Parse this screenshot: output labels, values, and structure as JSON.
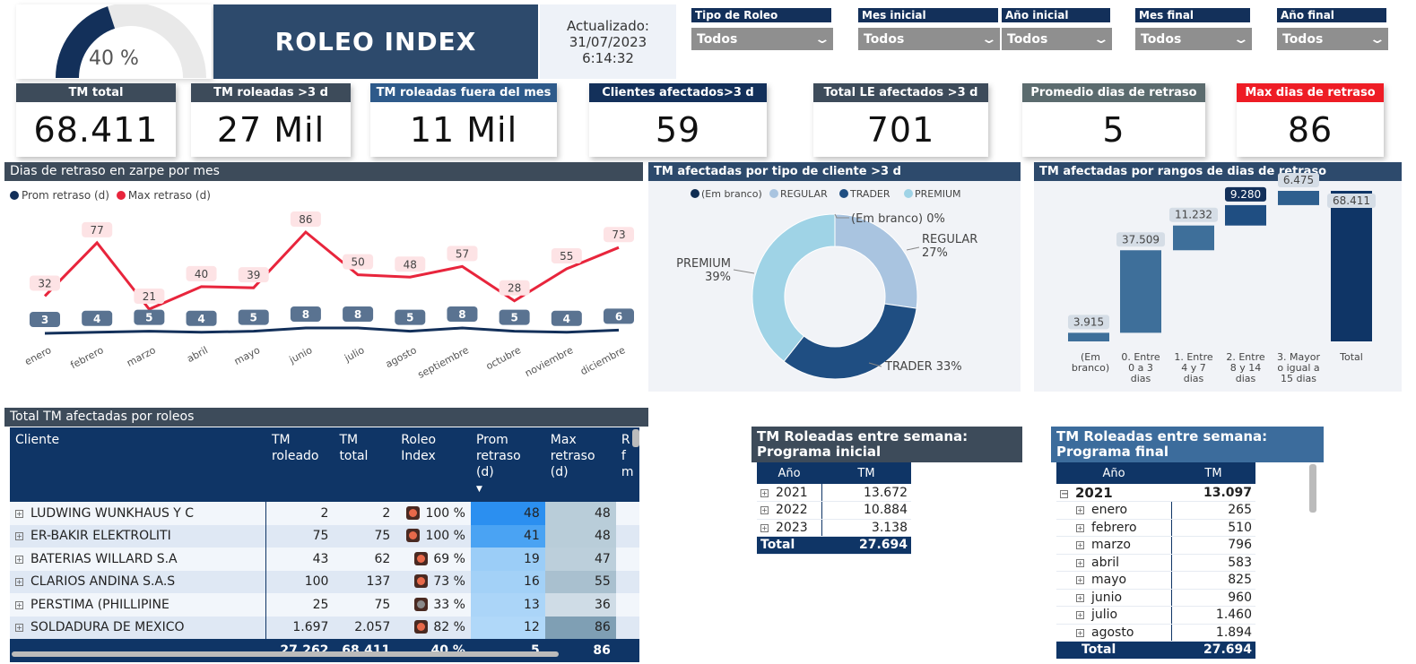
{
  "gauge": {
    "value_percent": 40,
    "label": "40 %",
    "fill_color": "#13305a",
    "track_color": "#e9e9e9"
  },
  "header": {
    "title": "ROLEO INDEX",
    "updated_label": "Actualizado:",
    "updated_date": "31/07/2023",
    "updated_time": "6:14:32"
  },
  "filters": [
    {
      "label": "Tipo de Roleo",
      "value": "Todos"
    },
    {
      "label": "Mes inicial",
      "value": "Todos"
    },
    {
      "label": "Año inicial",
      "value": "Todos"
    },
    {
      "label": "Mes final",
      "value": "Todos"
    },
    {
      "label": "Año final",
      "value": "Todos"
    }
  ],
  "kpis": [
    {
      "label": "TM total",
      "value": "68.411",
      "color": "#3d4b5a"
    },
    {
      "label": "TM roleadas >3 d",
      "value": "27 Mil",
      "color": "#3d4b5a"
    },
    {
      "label": "TM roleadas fuera del mes",
      "value": "11 Mil",
      "color": "#2e5a8a"
    },
    {
      "label": "Clientes afectados>3 d",
      "value": "59",
      "color": "#13305a"
    },
    {
      "label": "Total LE afectados >3 d",
      "value": "701",
      "color": "#3d4b5a"
    },
    {
      "label": "Promedio dias de retraso",
      "value": "5",
      "color": "#5b6b6e"
    },
    {
      "label": "Max dias de retraso",
      "value": "86",
      "color": "#ee1c25"
    }
  ],
  "line_section": {
    "title": "Dias de retraso en zarpe por mes",
    "legend": [
      {
        "name": "Prom retraso (d)",
        "color": "#13305a"
      },
      {
        "name": "Max retraso (d)",
        "color": "#e8253c"
      }
    ]
  },
  "donut_section": {
    "title": "TM afectadas por tipo de cliente >3 d",
    "legend": [
      {
        "name": "(Em branco)",
        "color": "#0f2d52"
      },
      {
        "name": "REGULAR",
        "color": "#a9c4e0"
      },
      {
        "name": "TRADER",
        "color": "#1f4e82"
      },
      {
        "name": "PREMIUM",
        "color": "#9fd3e6"
      }
    ]
  },
  "water_section": {
    "title": "TM afectadas por rangos de dias de retraso"
  },
  "chart_data": [
    {
      "type": "line",
      "x": [
        "enero",
        "febrero",
        "marzo",
        "abril",
        "mayo",
        "junio",
        "julio",
        "agosto",
        "septiembre",
        "octubre",
        "noviembre",
        "diciembre"
      ],
      "series": [
        {
          "name": "Prom retraso (d)",
          "values": [
            3,
            4,
            5,
            4,
            5,
            8,
            8,
            5,
            8,
            5,
            4,
            6
          ]
        },
        {
          "name": "Max retraso (d)",
          "values": [
            32,
            77,
            21,
            40,
            39,
            86,
            50,
            48,
            57,
            28,
            55,
            73
          ]
        }
      ],
      "title": "Dias de retraso en zarpe por mes"
    },
    {
      "type": "pie",
      "categories": [
        "(Em branco)",
        "REGULAR",
        "TRADER",
        "PREMIUM"
      ],
      "values": [
        0,
        27,
        33,
        39
      ],
      "slice_labels": [
        "(Em branco) 0%",
        "REGULAR 27%",
        "TRADER 33%",
        "PREMIUM 39%"
      ],
      "title": "TM afectadas por tipo de cliente >3 d"
    },
    {
      "type": "bar",
      "subtype": "waterfall",
      "categories": [
        "(Em branco)",
        "0. Entre 0 a 3 dias",
        "1. Entre 4 y 7 dias",
        "2. Entre 8 y 14 dias",
        "3. Mayor o igual a 15 dias",
        "Total"
      ],
      "values": [
        3915,
        37509,
        11232,
        9280,
        6475,
        68411
      ],
      "value_labels": [
        "3.915",
        "37.509",
        "11.232",
        "9.280",
        "6.475",
        "68.411"
      ],
      "title": "TM afectadas por rangos de dias de retraso"
    }
  ],
  "main_table": {
    "title": "Total TM afectadas por roleos",
    "columns": [
      "Cliente",
      "TM roleado",
      "TM total",
      "Roleo Index",
      "Prom retraso (d)",
      "Max retraso (d)"
    ],
    "rows": [
      {
        "cliente": "LUDWING WUNKHAUS Y C",
        "tm_roleado": "2",
        "tm_total": "2",
        "index": "100 %",
        "ind": "red",
        "prom": "48",
        "max": "48",
        "prom_color": "#2b8ff0",
        "max_color": "#b9cdd9"
      },
      {
        "cliente": "ER-BAKIR ELEKTROLITI",
        "tm_roleado": "75",
        "tm_total": "75",
        "index": "100 %",
        "ind": "red",
        "prom": "41",
        "max": "48",
        "prom_color": "#4aa3f3",
        "max_color": "#b9cdd9"
      },
      {
        "cliente": "BATERIAS WILLARD S.A",
        "tm_roleado": "43",
        "tm_total": "62",
        "index": "69 %",
        "ind": "red",
        "prom": "19",
        "max": "47",
        "prom_color": "#9bcdf7",
        "max_color": "#bccfdb"
      },
      {
        "cliente": "CLARIOS ANDINA S.A.S",
        "tm_roleado": "100",
        "tm_total": "137",
        "index": "73 %",
        "ind": "red",
        "prom": "16",
        "max": "55",
        "prom_color": "#a3d1f7",
        "max_color": "#a9c0cf"
      },
      {
        "cliente": "PERSTIMA (PHILLIPINE",
        "tm_roleado": "25",
        "tm_total": "75",
        "index": "33 %",
        "ind": "gray",
        "prom": "13",
        "max": "36",
        "prom_color": "#abd5f8",
        "max_color": "#cfdce6"
      },
      {
        "cliente": "SOLDADURA DE MEXICO",
        "tm_roleado": "1.697",
        "tm_total": "2.057",
        "index": "82 %",
        "ind": "red",
        "prom": "12",
        "max": "86",
        "prom_color": "#b0d8f9",
        "max_color": "#7f9fb4"
      }
    ],
    "totals": {
      "tm_roleado": "27.262",
      "tm_total": "68.411",
      "index": "40 %",
      "prom": "5",
      "max": "86"
    }
  },
  "week_initial": {
    "title_line1": "TM Roleadas entre semana:",
    "title_line2": "Programa inicial",
    "head_color": "#3d4b5a",
    "col_year": "Año",
    "col_tm": "TM",
    "rows": [
      {
        "year": "2021",
        "tm": "13.672"
      },
      {
        "year": "2022",
        "tm": "10.884"
      },
      {
        "year": "2023",
        "tm": "3.138"
      }
    ],
    "total_label": "Total",
    "total_tm": "27.694"
  },
  "week_final": {
    "title_line1": "TM Roleadas entre semana:",
    "title_line2": "Programa final",
    "head_color": "#3c6c9c",
    "col_year": "Año",
    "col_tm": "TM",
    "group": {
      "year": "2021",
      "tm": "13.097"
    },
    "rows": [
      {
        "month": "enero",
        "tm": "265"
      },
      {
        "month": "febrero",
        "tm": "510"
      },
      {
        "month": "marzo",
        "tm": "796"
      },
      {
        "month": "abril",
        "tm": "583"
      },
      {
        "month": "mayo",
        "tm": "825"
      },
      {
        "month": "junio",
        "tm": "960"
      },
      {
        "month": "julio",
        "tm": "1.460"
      },
      {
        "month": "agosto",
        "tm": "1.894"
      }
    ],
    "total_label": "Total",
    "total_tm": "27.694"
  }
}
